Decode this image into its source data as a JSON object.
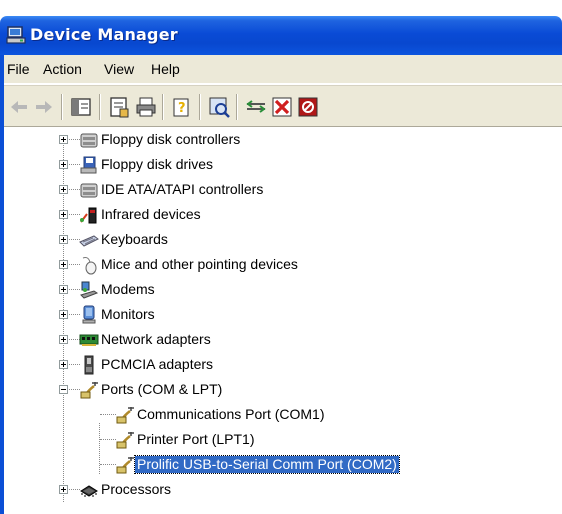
{
  "window": {
    "title": "Device Manager",
    "title_icon": "device-manager-icon"
  },
  "menu": {
    "items": [
      "File",
      "Action",
      "View",
      "Help"
    ]
  },
  "toolbar": {
    "buttons": [
      "back-arrow-icon",
      "forward-arrow-icon",
      "show-hide-console-tree-icon",
      "properties-icon",
      "print-icon",
      "help-icon",
      "scan-hardware-icon",
      "update-driver-icon",
      "uninstall-icon",
      "disable-icon"
    ]
  },
  "tree": {
    "selected_color": "#316ac5",
    "items": [
      {
        "label": "Floppy disk controllers",
        "icon": "floppy-controller-icon",
        "expanded": false
      },
      {
        "label": "Floppy disk drives",
        "icon": "floppy-drive-icon",
        "expanded": false
      },
      {
        "label": "IDE ATA/ATAPI controllers",
        "icon": "ide-controller-icon",
        "expanded": false
      },
      {
        "label": "Infrared devices",
        "icon": "infrared-icon",
        "expanded": false
      },
      {
        "label": "Keyboards",
        "icon": "keyboard-icon",
        "expanded": false
      },
      {
        "label": "Mice and other pointing devices",
        "icon": "mouse-icon",
        "expanded": false
      },
      {
        "label": "Modems",
        "icon": "modem-icon",
        "expanded": false
      },
      {
        "label": "Monitors",
        "icon": "monitor-icon",
        "expanded": false
      },
      {
        "label": "Network adapters",
        "icon": "network-adapter-icon",
        "expanded": false
      },
      {
        "label": "PCMCIA adapters",
        "icon": "pcmcia-icon",
        "expanded": false
      },
      {
        "label": "Ports (COM & LPT)",
        "icon": "port-icon",
        "expanded": true
      },
      {
        "label": "Communications Port (COM1)",
        "icon": "port-icon",
        "child": true
      },
      {
        "label": "Printer Port (LPT1)",
        "icon": "port-icon",
        "child": true
      },
      {
        "label": "Prolific USB-to-Serial Comm Port (COM2)",
        "icon": "port-icon",
        "child": true,
        "selected": true
      },
      {
        "label": "Processors",
        "icon": "processor-icon",
        "expanded": false
      }
    ]
  }
}
